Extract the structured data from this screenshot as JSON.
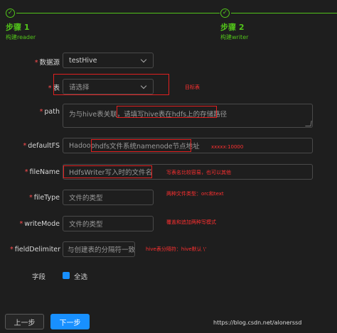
{
  "steps": [
    {
      "title": "步骤 1",
      "desc": "构建reader"
    },
    {
      "title": "步骤 2",
      "desc": "构建writer"
    }
  ],
  "form": {
    "datasource": {
      "label": "数据源",
      "value": "testHive"
    },
    "table": {
      "label": "表",
      "placeholder": "请选择"
    },
    "path": {
      "label": "path",
      "placeholder_prefix": "为与hive表关联，",
      "placeholder_highlight": "请填写hive表在hdfs上的存储路径"
    },
    "defaultFS": {
      "label": "defaultFS",
      "placeholder_prefix": "Hadoop ",
      "placeholder_highlight": "hdfs文件系统namenode节点地址"
    },
    "fileName": {
      "label": "fileName",
      "placeholder": "HdfsWriter写入时的文件名"
    },
    "fileType": {
      "label": "fileType",
      "placeholder": "文件的类型"
    },
    "writeMode": {
      "label": "writeMode",
      "placeholder": "文件的类型"
    },
    "fieldDelimiter": {
      "label": "fieldDelimiter",
      "placeholder": "与创建表的分隔符一致"
    },
    "fields": {
      "label": "字段",
      "select_all": "全选"
    }
  },
  "annotations": {
    "table": "目标表",
    "defaultFS": "xxxxx:10000",
    "fileName": "写表名比较容易，也可以其他",
    "fileType": "两种文件类型：orc和text",
    "writeMode": "覆盖和追加两种写模式",
    "fieldDelimiter": "hive表分隔符：hive默认 \\'"
  },
  "buttons": {
    "prev": "上一步",
    "next": "下一步"
  },
  "watermark": "https://blog.csdn.net/alonerssd",
  "colors": {
    "accent": "#1890ff",
    "success": "#52c41a",
    "annotation": "#e02020"
  }
}
